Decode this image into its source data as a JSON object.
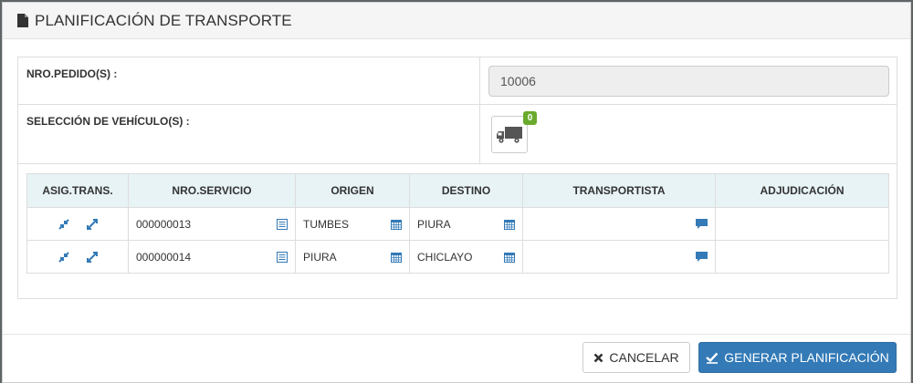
{
  "modal": {
    "title": "PLANIFICACIÓN DE TRANSPORTE",
    "title_icon": "file-icon"
  },
  "form": {
    "pedido_label": "NRO.PEDIDO(S) :",
    "pedido_value": "10006",
    "vehiculo_label": "SELECCIÓN DE VEHÍCULO(S) :",
    "vehiculo_icon": "truck-icon",
    "vehiculo_count": "0"
  },
  "table": {
    "headers": {
      "asig": "ASIG.TRANS.",
      "servicio": "NRO.SERVICIO",
      "origen": "ORIGEN",
      "destino": "DESTINO",
      "transportista": "TRANSPORTISTA",
      "adjudicacion": "ADJUDICACIÓN"
    },
    "rows": [
      {
        "servicio": "000000013",
        "origen": "TUMBES",
        "destino": "PIURA",
        "transportista": "",
        "adjudicacion": ""
      },
      {
        "servicio": "000000014",
        "origen": "PIURA",
        "destino": "CHICLAYO",
        "transportista": "",
        "adjudicacion": ""
      }
    ]
  },
  "footer": {
    "cancel_label": "CANCELAR",
    "generate_label": "GENERAR PLANIFICACIÓN"
  },
  "colors": {
    "header_bg": "#e8f3f6",
    "primary": "#337ab7",
    "icon_blue": "#337ab7",
    "badge_green": "#6aaa2c"
  }
}
